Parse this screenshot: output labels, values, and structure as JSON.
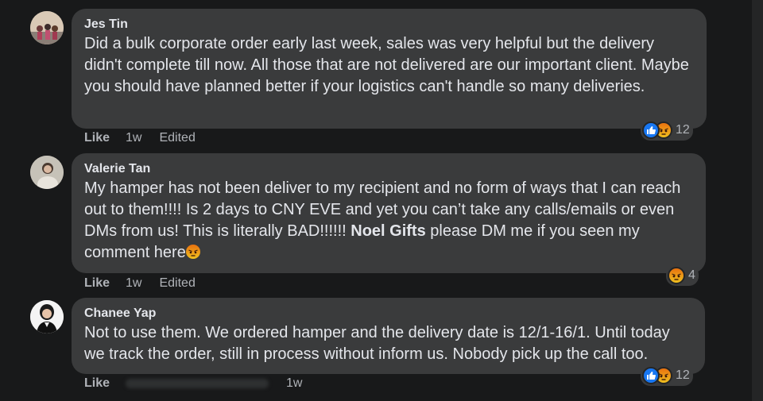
{
  "comments": [
    {
      "author": "Jes Tin",
      "text": "Did a bulk corporate order early last week, sales was very helpful but the delivery didn't complete till now. All those that are not delivered are our important client. Maybe you should have planned better if your logistics can't handle so many deliveries.",
      "like_label": "Like",
      "time": "1w",
      "edited_label": "Edited",
      "reaction_count": "12",
      "reactions": [
        "like-icon",
        "angry-icon"
      ]
    },
    {
      "author": "Valerie Tan",
      "text_before": "My hamper has not been deliver to my recipient and no form of ways that I can reach out to them!!!! Is 2 days to CNY EVE and yet you can’t take any calls/emails or even DMs from us! This is literally BAD!!!!!! ",
      "mention": "Noel Gifts",
      "text_after": " please DM me if you seen my comment here",
      "like_label": "Like",
      "time": "1w",
      "edited_label": "Edited",
      "reaction_count": "4",
      "reactions": [
        "angry-icon"
      ]
    },
    {
      "author": "Chanee Yap",
      "text": "Not to use them. We ordered hamper and the delivery date is 12/1-16/1. Until today we track the order, still in process without inform us. Nobody pick up the call too.",
      "like_label": "Like",
      "time": "1w",
      "reaction_count": "12",
      "reactions": [
        "like-icon",
        "angry-icon"
      ]
    }
  ],
  "colors": {
    "background": "#18191a",
    "bubble": "#3a3b3c",
    "text": "#e4e6eb",
    "secondary_text": "#b0b3b8",
    "like_blue": "#1877f2",
    "angry_orange": "#e9710f"
  }
}
